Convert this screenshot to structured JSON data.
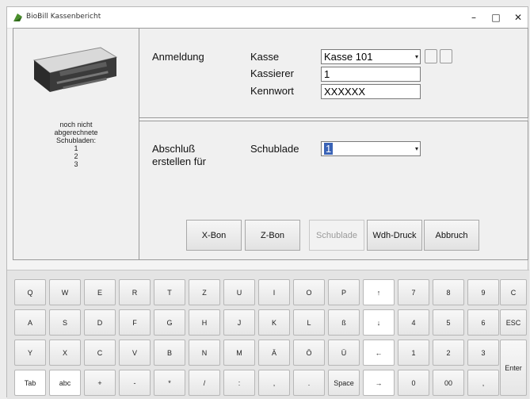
{
  "window": {
    "title": "BioBill Kassenbericht",
    "minimize": "–",
    "maximize": "□",
    "close": "✕"
  },
  "left_panel": {
    "info_lines": [
      "noch nicht",
      "abgerechnete",
      "Schubladen:",
      "1",
      "2",
      "3"
    ]
  },
  "login": {
    "section_label": "Anmeldung",
    "register_label": "Kasse",
    "register_value": "Kasse 101",
    "cashier_label": "Kassierer",
    "cashier_value": "1",
    "password_label": "Kennwort",
    "password_value": "XXXXXX"
  },
  "closing": {
    "section_label_line1": "Abschluß",
    "section_label_line2": "erstellen für",
    "drawer_label": "Schublade",
    "drawer_value": "1"
  },
  "actions": [
    {
      "name": "x-bon-button",
      "label": "X-Bon",
      "enabled": true
    },
    {
      "name": "z-bon-button",
      "label": "Z-Bon",
      "enabled": true
    },
    {
      "name": "schublade-button",
      "label": "Schublade",
      "enabled": false
    },
    {
      "name": "wdh-druck-button",
      "label": "Wdh-Druck",
      "enabled": true
    },
    {
      "name": "abbruch-button",
      "label": "Abbruch",
      "enabled": true
    }
  ],
  "keyboard": {
    "row1": [
      "Q",
      "W",
      "E",
      "R",
      "T",
      "Z",
      "U",
      "I",
      "O",
      "P",
      "↑",
      "7",
      "8",
      "9",
      "C"
    ],
    "row2": [
      "A",
      "S",
      "D",
      "F",
      "G",
      "H",
      "J",
      "K",
      "L",
      "ß",
      "↓",
      "4",
      "5",
      "6",
      "ESC"
    ],
    "row3": [
      "Y",
      "X",
      "C",
      "V",
      "B",
      "N",
      "M",
      "Ä",
      "Ö",
      "Ü",
      "←",
      "1",
      "2",
      "3"
    ],
    "row4": [
      "Tab",
      "abc",
      "+",
      "-",
      "*",
      "/",
      ":",
      ",",
      ".",
      "Space",
      "→",
      "0",
      "00",
      ","
    ],
    "enter": "Enter"
  }
}
